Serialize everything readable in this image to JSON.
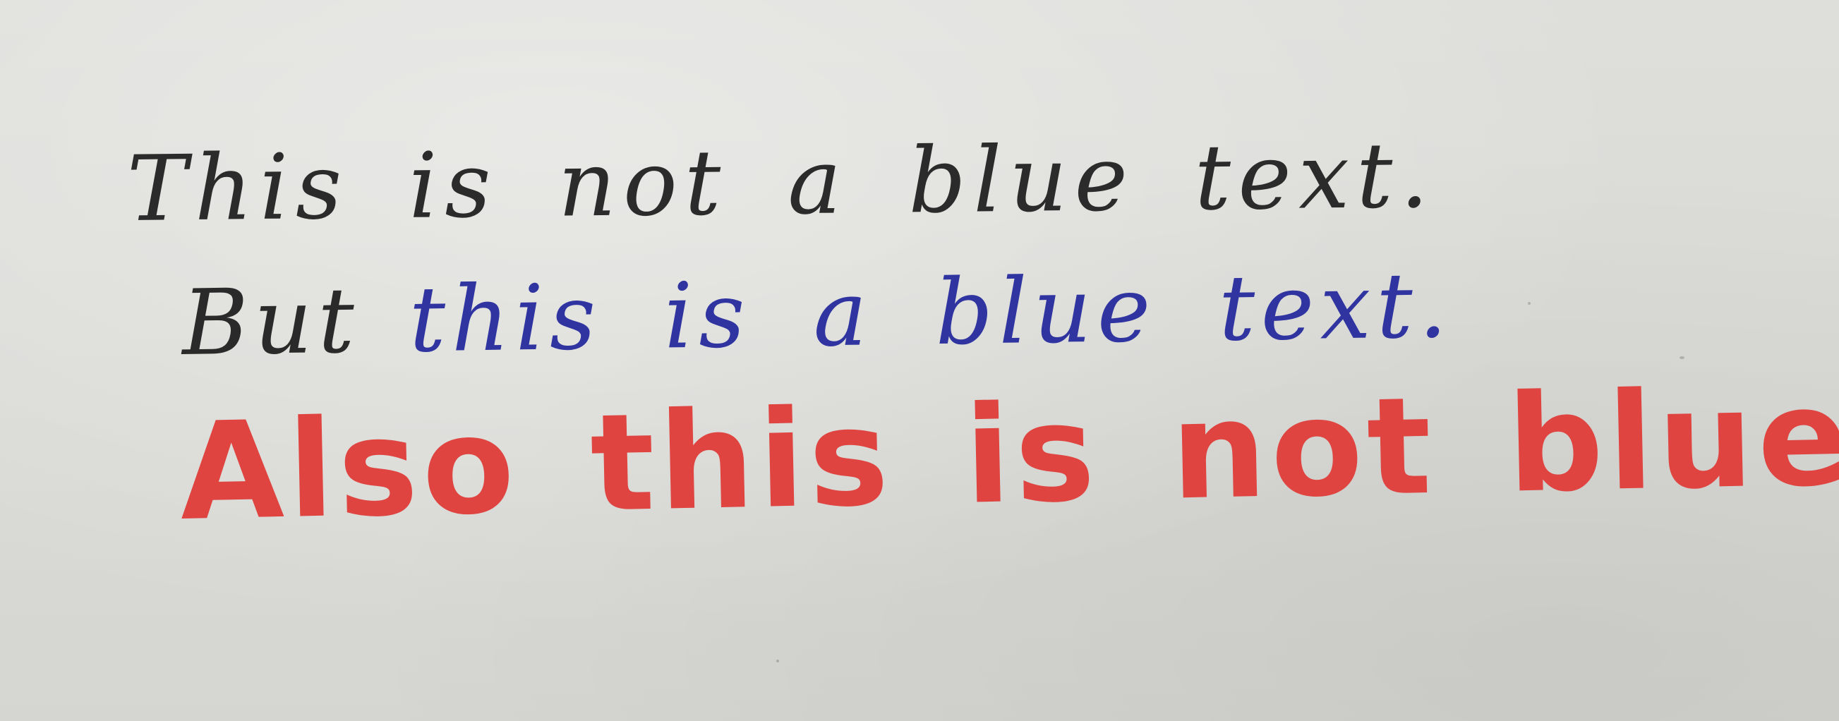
{
  "handwriting": {
    "line1": "This is not a blue text.",
    "line2_black": "But",
    "line2_blue": "this is a blue text.",
    "line3": "Also this is not blue."
  },
  "colors": {
    "paper": "#dadad6",
    "black_ink": "#2b2b2b",
    "blue_ink": "#2f34a0",
    "red_marker": "#df4440"
  }
}
